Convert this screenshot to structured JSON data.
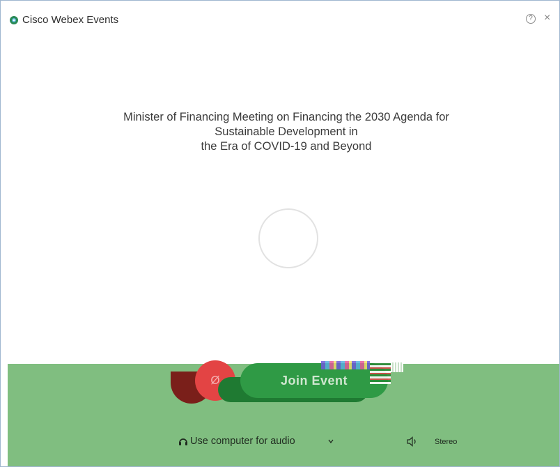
{
  "window": {
    "app_title": "Cisco Webex Events",
    "help_glyph": "?",
    "close_glyph": "×"
  },
  "meeting": {
    "title_lines": [
      "Minister of Financing Meeting on Financing the 2030 Agenda for",
      "Sustainable Development in",
      "the Era of COVID-19 and Beyond"
    ]
  },
  "controls": {
    "join_label": "Join Event",
    "mute_glyph": "Ø"
  },
  "audio": {
    "option_label": "Use computer for audio",
    "mode_label": "Stereo"
  },
  "icons": {
    "app_logo": "webex-logo-icon",
    "help": "help-icon",
    "close": "close-icon",
    "headset": "headset-icon",
    "chevron": "chevron-down-icon",
    "speaker": "speaker-icon"
  },
  "colors": {
    "panel_green": "#80be80",
    "join_green": "#2f9a45",
    "mute_red": "#e34444"
  }
}
